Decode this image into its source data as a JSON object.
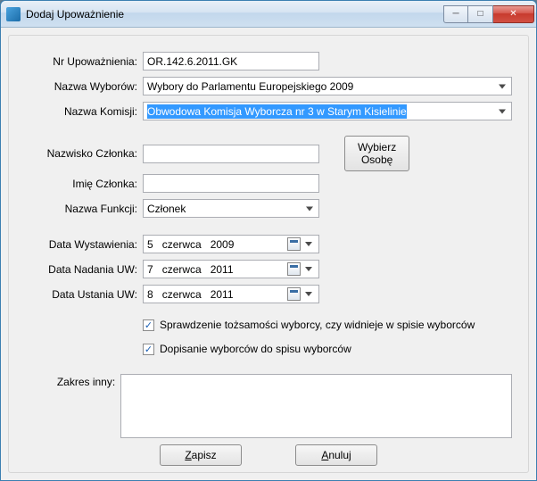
{
  "window": {
    "title": "Dodaj Upoważnienie"
  },
  "labels": {
    "nr": "Nr Upoważnienia:",
    "wybory": "Nazwa Wyborów:",
    "komisja": "Nazwa Komisji:",
    "nazwisko": "Nazwisko Członka:",
    "imie": "Imię Członka:",
    "funkcja": "Nazwa Funkcji:",
    "dataWyst": "Data Wystawienia:",
    "dataNadania": "Data Nadania UW:",
    "dataUstania": "Data Ustania UW:",
    "zakres": "Zakres inny:"
  },
  "values": {
    "nr": "OR.142.6.2011.GK",
    "wybory": "Wybory do Parlamentu Europejskiego 2009",
    "komisja": "Obwodowa Komisja Wyborcza nr 3 w Starym Kisielinie",
    "nazwisko": "",
    "imie": "",
    "funkcja": "Członek",
    "zakres": ""
  },
  "dates": {
    "wyst": {
      "d": "5",
      "m": "czerwca",
      "y": "2009"
    },
    "nadania": {
      "d": "7",
      "m": "czerwca",
      "y": "2011"
    },
    "ustania": {
      "d": "8",
      "m": "czerwca",
      "y": "2011"
    }
  },
  "checks": {
    "sprawdzenie": {
      "checked": true,
      "label": "Sprawdzenie tożsamości wyborcy, czy widnieje w spisie wyborców"
    },
    "dopisanie": {
      "checked": true,
      "label": "Dopisanie wyborców do spisu wyborców"
    }
  },
  "buttons": {
    "wybierz1": "Wybierz",
    "wybierz2": "Osobę",
    "zapisz": "Zapisz",
    "anuluj": "Anuluj"
  }
}
